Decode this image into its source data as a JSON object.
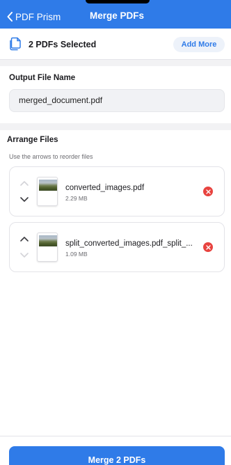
{
  "header": {
    "back_label": "PDF Prism",
    "title": "Merge PDFs"
  },
  "selection": {
    "count_text": "2 PDFs Selected",
    "add_more_label": "Add More"
  },
  "output": {
    "label": "Output File Name",
    "value": "merged_document.pdf"
  },
  "arrange": {
    "title": "Arrange Files",
    "hint": "Use the arrows to reorder files",
    "files": [
      {
        "name": "converted_images.pdf",
        "size": "2.29 MB"
      },
      {
        "name": "split_converted_images.pdf_split_...",
        "size": "1.09 MB"
      }
    ]
  },
  "footer": {
    "merge_label": "Merge 2 PDFs"
  },
  "colors": {
    "accent": "#2f7be8",
    "danger": "#e8433f",
    "background": "#f2f2f4"
  },
  "icons": {
    "back": "chevron-left-icon",
    "documents": "documents-icon",
    "move_up": "chevron-up-icon",
    "move_down": "chevron-down-icon",
    "remove": "close-circle-icon"
  }
}
